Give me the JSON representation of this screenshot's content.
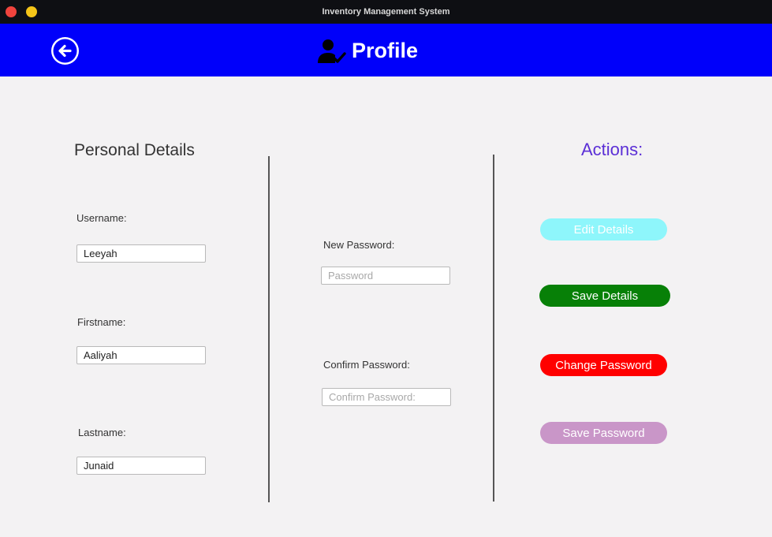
{
  "window": {
    "title": "Inventory Management System"
  },
  "header": {
    "title": "Profile"
  },
  "personal": {
    "title": "Personal Details",
    "username_label": "Username:",
    "username_value": "Leeyah",
    "firstname_label": "Firstname:",
    "firstname_value": "Aaliyah",
    "lastname_label": "Lastname:",
    "lastname_value": "Junaid"
  },
  "password": {
    "new_label": "New Password:",
    "new_placeholder": "Password",
    "confirm_label": "Confirm Password:",
    "confirm_placeholder": "Confirm Password:"
  },
  "actions": {
    "title": "Actions:",
    "edit_label": "Edit Details",
    "save_details_label": "Save Details",
    "change_password_label": "Change Password",
    "save_password_label": "Save Password"
  },
  "colors": {
    "header_bg": "#0000fa",
    "actions_title": "#5b2fd6",
    "edit_btn": "#8ef6fb",
    "save_details_btn": "#078007",
    "change_password_btn": "#ff0000",
    "save_password_btn": "#c996c8"
  },
  "icons": {
    "back": "arrow-left-circle-icon",
    "profile": "user-check-icon"
  }
}
